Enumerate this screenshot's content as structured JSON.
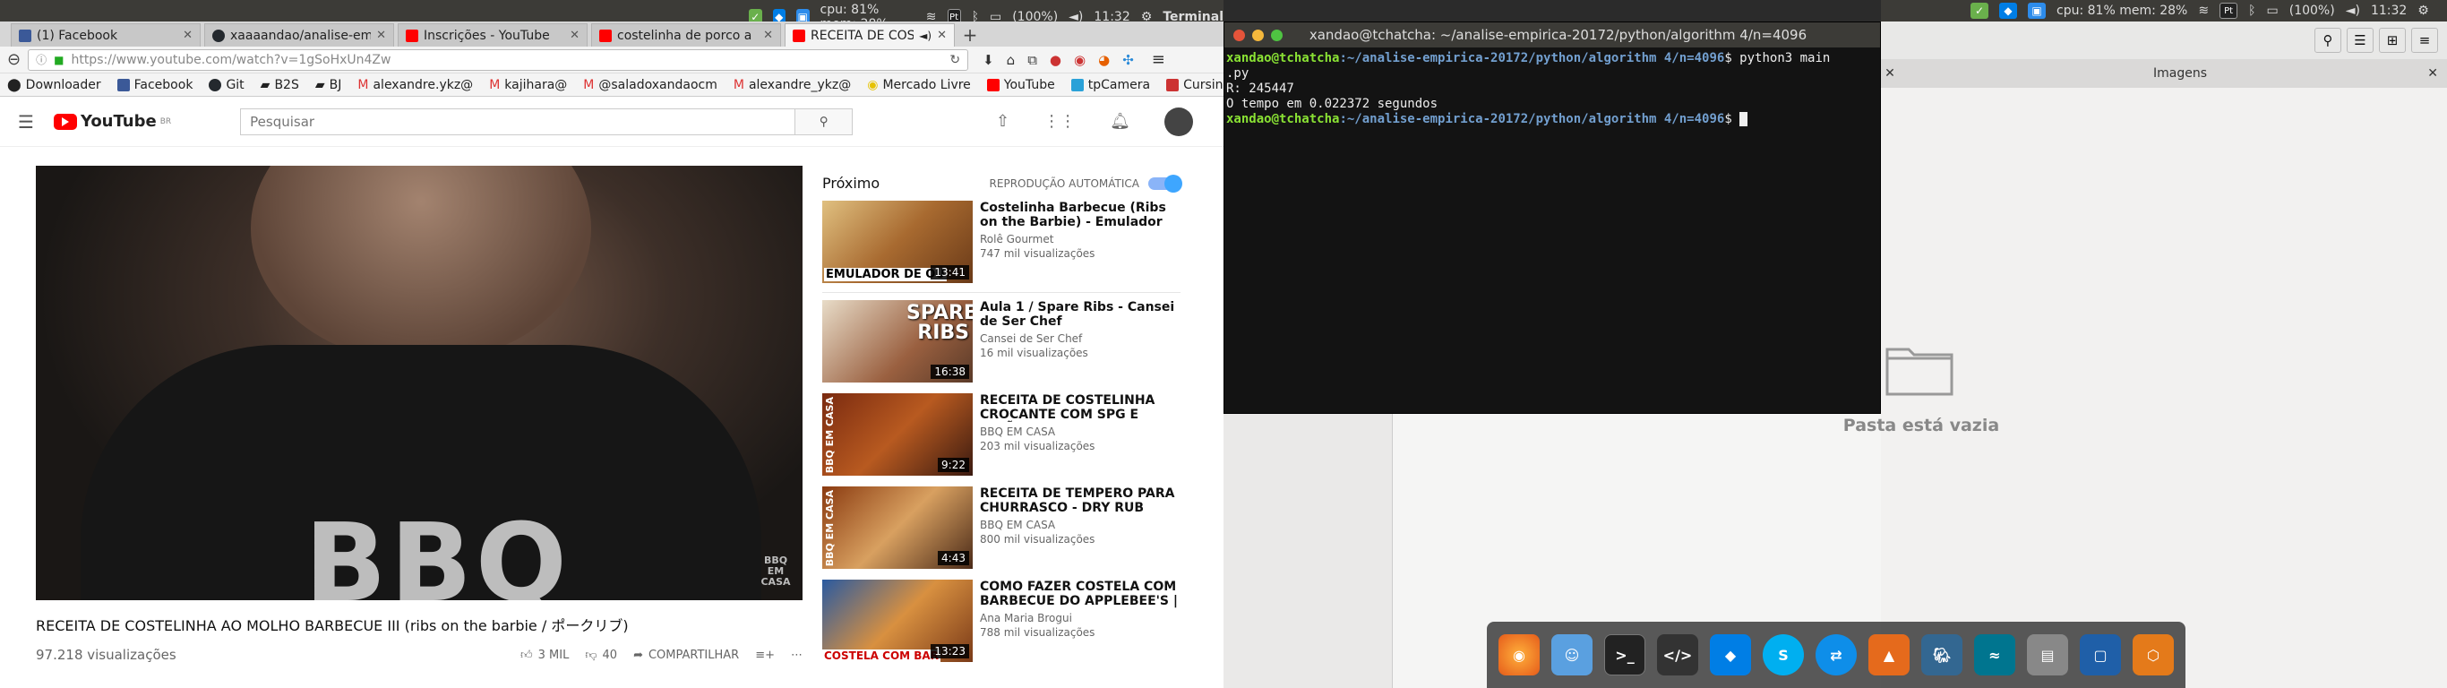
{
  "top_panel_left": {
    "cpu_mem": "cpu: 81% mem: 28%",
    "battery": "(100%)",
    "clock": "11:32",
    "app_name": "Terminal"
  },
  "top_panel_right": {
    "cpu_mem": "cpu: 81% mem: 28%",
    "battery": "(100%)",
    "clock": "11:32"
  },
  "browser": {
    "tabs": [
      {
        "label": "(1) Facebook",
        "favicon_color": "#3b5998"
      },
      {
        "label": "xaaaandao/analise-em",
        "favicon_color": "#24292e"
      },
      {
        "label": "Inscrições - YouTube",
        "favicon_color": "#ff0000"
      },
      {
        "label": "costelinha de porco a",
        "favicon_color": "#ff0000"
      },
      {
        "label": "RECEITA DE COSTE",
        "favicon_color": "#ff0000"
      }
    ],
    "url": "https://www.youtube.com/watch?v=1gSoHxUn4Zw",
    "bookmarks": [
      "Downloader",
      "Facebook",
      "Git",
      "B2S",
      "BJ",
      "alexandre.ykz@",
      "kajihara@",
      "@saladoxandaocm",
      "alexandre_ykz@",
      "Mercado Livre",
      "YouTube",
      "tpCamera",
      "Cursinho"
    ]
  },
  "youtube": {
    "logo": "YouTube",
    "logo_region": "BR",
    "search_placeholder": "Pesquisar",
    "video_overlay": "BBQ",
    "watermark": "BBQ EM CASA",
    "title": "RECEITA DE COSTELINHA AO MOLHO BARBECUE III (ribs on the barbie / ポークリブ)",
    "views": "97.218 visualizações",
    "likes": "3 MIL",
    "dislikes": "40",
    "share": "COMPARTILHAR",
    "up_next": "Próximo",
    "autoplay": "REPRODUÇÃO AUTOMÁTICA",
    "recommendations": [
      {
        "title": "Costelinha Barbecue (Ribs on the Barbie) - Emulador de",
        "channel": "Rolê Gourmet",
        "views": "747 mil visualizações",
        "duration": "13:41",
        "thumb_text": "EMULADOR DE OU"
      },
      {
        "title": "Aula 1 / Spare Ribs - Cansei de Ser Chef",
        "channel": "Cansei de Ser Chef",
        "views": "16 mil visualizações",
        "duration": "16:38",
        "thumb_text": "SPARE RIBS"
      },
      {
        "title": "RECEITA DE COSTELINHA CROCANTE COM SPG E LIMÃO",
        "channel": "BBQ EM CASA",
        "views": "203 mil visualizações",
        "duration": "9:22",
        "thumb_text": "BBQ EM CASA"
      },
      {
        "title": "RECEITA DE TEMPERO PARA CHURRASCO - DRY RUB",
        "channel": "BBQ EM CASA",
        "views": "800 mil visualizações",
        "duration": "4:43",
        "thumb_text": "BBQ EM CASA"
      },
      {
        "title": "COMO FAZER COSTELA COM BARBECUE DO APPLEBEE'S |",
        "channel": "Ana Maria Brogui",
        "views": "788 mil visualizações",
        "duration": "13:23",
        "thumb_text": "COSTELA COM BAR"
      }
    ]
  },
  "terminal": {
    "title": "xandao@tchatcha: ~/analise-empirica-20172/python/algorithm 4/n=4096",
    "user_host": "xandao@tchatcha",
    "path": ":~/analise-empirica-20172/python/algorithm 4/n=4096",
    "command": "$ python3 main",
    "command_wrap": ".py",
    "out1": "R: 245447",
    "out2": "O tempo em 0.022372 segundos",
    "prompt_end": "$ "
  },
  "file_manager": {
    "tab_label": "Imagens",
    "empty_text": "Pasta está vazia"
  },
  "dock": [
    "firefox-icon",
    "finder-icon",
    "terminal-icon",
    "code-editor-icon",
    "dropbox-icon",
    "skype-icon",
    "teamviewer-icon",
    "matlab-icon",
    "postgres-icon",
    "mysql-workbench-icon",
    "disk-icon",
    "virtualbox-icon",
    "vm-icon"
  ]
}
